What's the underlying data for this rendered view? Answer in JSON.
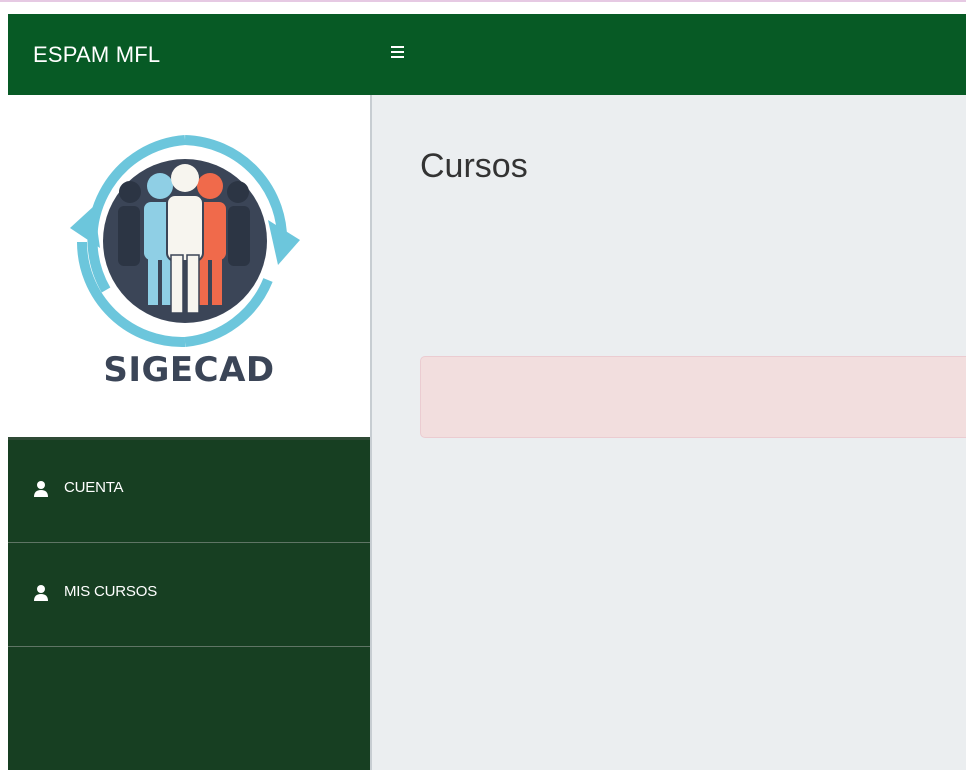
{
  "app": {
    "brand": "ESPAM MFL"
  },
  "logo": {
    "text": "SIGECAD"
  },
  "sidebar": {
    "items": [
      {
        "label": "CUENTA",
        "icon": "user-icon"
      },
      {
        "label": "MIS CURSOS",
        "icon": "user-icon"
      }
    ]
  },
  "main": {
    "title": "Cursos",
    "alert": ""
  },
  "colors": {
    "navbar": "#075a25",
    "sidebar": "#173f22",
    "content_bg": "#ebeef0",
    "alert_bg": "#f2dede",
    "logo_ring": "#6cc6dc",
    "logo_circle": "#3b4557"
  }
}
